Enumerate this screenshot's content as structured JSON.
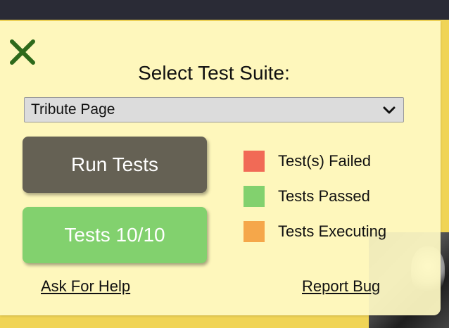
{
  "panel": {
    "title": "Select Test Suite:",
    "close_icon": "close-x-icon",
    "suite_select": {
      "selected": "Tribute Page",
      "icon": "chevron-down-icon"
    },
    "run_button": {
      "label": "Run Tests"
    },
    "result_button": {
      "label": "Tests 10/10"
    },
    "legend": [
      {
        "label": "Test(s) Failed",
        "color": "#f16a56"
      },
      {
        "label": "Tests Passed",
        "color": "#82d16e"
      },
      {
        "label": "Tests Executing",
        "color": "#f5a74a"
      }
    ],
    "links": {
      "help": "Ask For Help",
      "bug": "Report Bug"
    }
  },
  "colors": {
    "panel_bg": "#fffac4",
    "close_icon": "#2e6a1b",
    "run_button": "#656154",
    "result_button": "#82d16e",
    "page_bg": "#f0d456"
  }
}
